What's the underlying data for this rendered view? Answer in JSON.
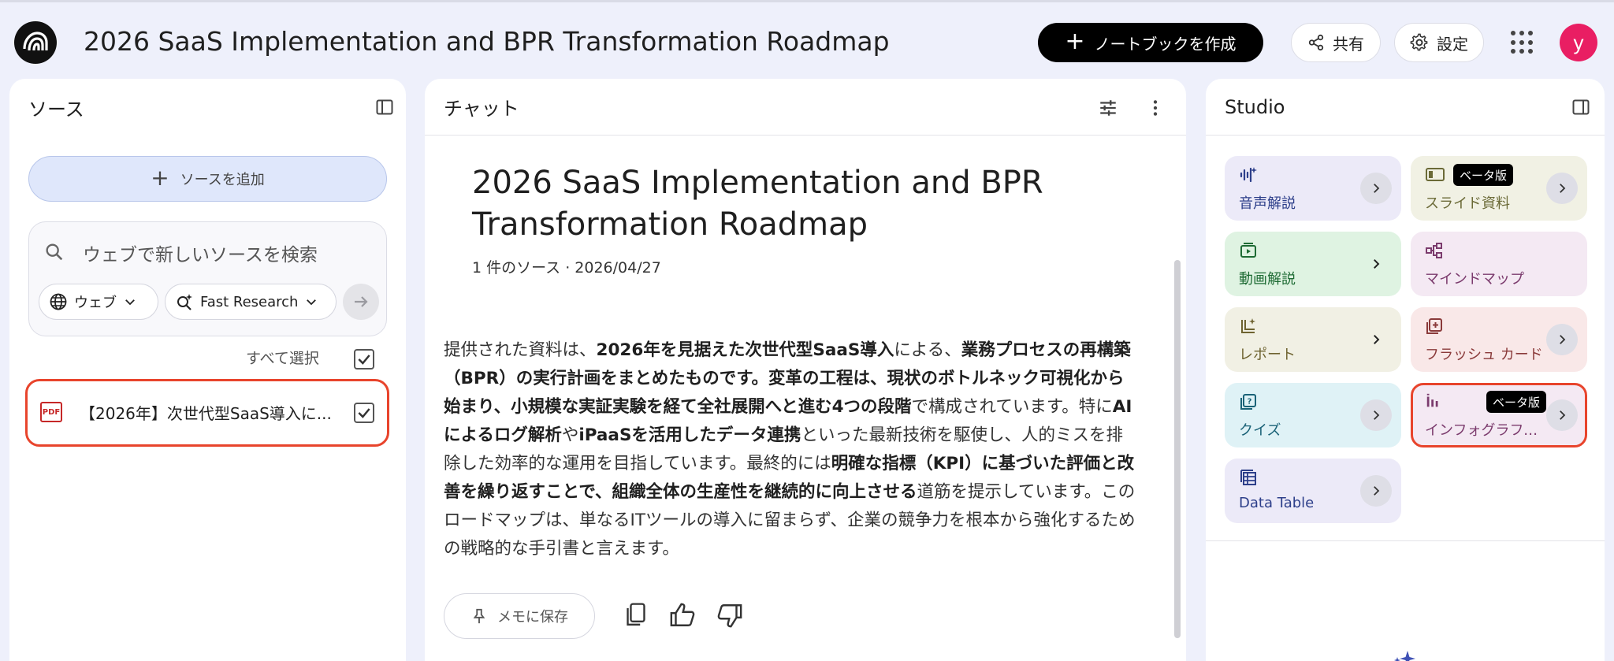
{
  "header": {
    "title": "2026 SaaS Implementation and BPR Transformation Roadmap",
    "create_notebook": "ノートブックを作成",
    "share": "共有",
    "settings": "設定",
    "avatar_initial": "y"
  },
  "sources": {
    "panel_title": "ソース",
    "add_source": "ソースを追加",
    "search_placeholder": "ウェブで新しいソースを検索",
    "chip_web": "ウェブ",
    "chip_research": "Fast Research",
    "select_all": "すべて選択",
    "items": [
      {
        "title": "【2026年】次世代型SaaS導入に...",
        "type_badge": "PDF"
      }
    ]
  },
  "chat": {
    "panel_title": "チャット",
    "title": "2026 SaaS Implementation and BPR Transformation Roadmap",
    "meta": "1 件のソース · 2026/04/27",
    "summary": [
      {
        "t": "提供された資料は、",
        "b": false
      },
      {
        "t": "2026年を見据えた次世代型SaaS導入",
        "b": true
      },
      {
        "t": "による、",
        "b": false
      },
      {
        "t": "業務プロセスの再構築（BPR）の実行計画をまとめたものです。変革の工程は、現状のボトルネック可視化から始まり、小規模な実証実験を経て全社展開へと進む4つの段階",
        "b": true
      },
      {
        "t": "で構成されています。特に",
        "b": false
      },
      {
        "t": "AIによるログ解析",
        "b": true
      },
      {
        "t": "や",
        "b": false
      },
      {
        "t": "iPaaSを活用したデータ連携",
        "b": true
      },
      {
        "t": "といった最新技術を駆使し、人的ミスを排除した効率的な運用を目指しています。最終的には",
        "b": false
      },
      {
        "t": "明確な指標（KPI）に基づいた評価と改善を繰り返すことで、組織全体の生産性を継続的に向上させる",
        "b": true
      },
      {
        "t": "道筋を提示しています。このロードマップは、単なるITツールの導入に留まらず、企業の競争力を根本から強化するための戦略的な手引書と言えます。",
        "b": false
      }
    ],
    "save_memo": "メモに保存"
  },
  "studio": {
    "panel_title": "Studio",
    "beta_label": "ベータ版",
    "tiles": [
      {
        "label": "音声解説",
        "bg": "#eceaf8",
        "fg": "#2d3f8a"
      },
      {
        "label": "スライド資料",
        "bg": "#f1f1e4",
        "fg": "#6b6a37"
      },
      {
        "label": "動画解説",
        "bg": "#dff3e2",
        "fg": "#1e6b34"
      },
      {
        "label": "マインドマップ",
        "bg": "#f4e9f3",
        "fg": "#7b3b6d"
      },
      {
        "label": "レポート",
        "bg": "#f1f0e4",
        "fg": "#6e6330"
      },
      {
        "label": "フラッシュ カード",
        "bg": "#f9e8e8",
        "fg": "#8a3a3a"
      },
      {
        "label": "クイズ",
        "bg": "#dff2f6",
        "fg": "#1a6277"
      },
      {
        "label": "インフォグラフィック",
        "bg": "#f4e9f3",
        "fg": "#7b3b6d"
      },
      {
        "label": "Data Table",
        "bg": "#eceaf8",
        "fg": "#2d3f8a"
      }
    ]
  }
}
